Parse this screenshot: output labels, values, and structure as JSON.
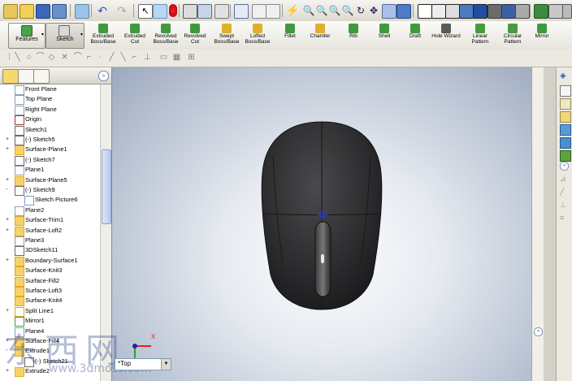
{
  "command_manager": {
    "features_tab": "Features",
    "sketch_tab": "Sketch",
    "commands": [
      {
        "label": "Extruded Boss/Base",
        "line1": "Extruded",
        "line2": "Boss/Base",
        "icon": "extrude-boss-icon"
      },
      {
        "label": "Extruded Cut",
        "line1": "Extruded",
        "line2": "Cut",
        "icon": "extrude-cut-icon"
      },
      {
        "label": "Revolved Boss/Base",
        "line1": "Revolved",
        "line2": "Boss/Base",
        "icon": "revolve-boss-icon"
      },
      {
        "label": "Revolved Cut",
        "line1": "Revolved",
        "line2": "Cut",
        "icon": "revolve-cut-icon"
      },
      {
        "label": "Swept Boss/Base",
        "line1": "Swept",
        "line2": "Boss/Base",
        "icon": "sweep-icon"
      },
      {
        "label": "Lofted Boss/Base",
        "line1": "Lofted",
        "line2": "Boss/Base",
        "icon": "loft-icon"
      },
      {
        "label": "Fillet",
        "line1": "Fillet",
        "line2": "",
        "icon": "fillet-icon"
      },
      {
        "label": "Chamfer",
        "line1": "Chamfer",
        "line2": "",
        "icon": "chamfer-icon"
      },
      {
        "label": "Rib",
        "line1": "Rib",
        "line2": "",
        "icon": "rib-icon"
      },
      {
        "label": "Shell",
        "line1": "Shell",
        "line2": "",
        "icon": "shell-icon"
      },
      {
        "label": "Draft",
        "line1": "Draft",
        "line2": "",
        "icon": "draft-icon"
      },
      {
        "label": "Hole Wizard",
        "line1": "Hole Wizard",
        "line2": "",
        "icon": "hole-wizard-icon"
      },
      {
        "label": "Linear Pattern",
        "line1": "Linear",
        "line2": "Pattern",
        "icon": "linear-pattern-icon"
      },
      {
        "label": "Circular Pattern",
        "line1": "Circular",
        "line2": "Pattern",
        "icon": "circular-pattern-icon"
      },
      {
        "label": "Mirror",
        "line1": "Mirror",
        "line2": "",
        "icon": "mirror-icon"
      }
    ]
  },
  "feature_tree": [
    {
      "label": "Front Plane",
      "icon": "plane-icon",
      "expand": ""
    },
    {
      "label": "Top Plane",
      "icon": "plane-icon",
      "expand": ""
    },
    {
      "label": "Right Plane",
      "icon": "plane-icon",
      "expand": ""
    },
    {
      "label": "Origin",
      "icon": "origin-icon",
      "expand": ""
    },
    {
      "label": "Sketch1",
      "icon": "sketch-icon",
      "expand": ""
    },
    {
      "label": "(-) Sketch5",
      "icon": "sketch-icon",
      "expand": "+"
    },
    {
      "label": "Surface-Plane1",
      "icon": "surface-plane-icon",
      "expand": "+"
    },
    {
      "label": "(-) Sketch7",
      "icon": "sketch-icon",
      "expand": ""
    },
    {
      "label": "Plane1",
      "icon": "plane-icon",
      "expand": ""
    },
    {
      "label": "Surface-Plane5",
      "icon": "surface-plane-icon",
      "expand": "+"
    },
    {
      "label": "(-) Sketch9",
      "icon": "sketch-icon",
      "expand": "-"
    },
    {
      "label": "Sketch Picture6",
      "icon": "sketch-picture-icon",
      "expand": "",
      "indent": 1
    },
    {
      "label": "Plane2",
      "icon": "plane-icon",
      "expand": ""
    },
    {
      "label": "Surface-Trim1",
      "icon": "surface-trim-icon",
      "expand": "+"
    },
    {
      "label": "Surface-Loft2",
      "icon": "surface-loft-icon",
      "expand": "+"
    },
    {
      "label": "Plane3",
      "icon": "plane-icon",
      "expand": ""
    },
    {
      "label": "3DSketch11",
      "icon": "3d-sketch-icon",
      "expand": ""
    },
    {
      "label": "Boundary-Surface1",
      "icon": "boundary-surface-icon",
      "expand": "+"
    },
    {
      "label": "Surface-Knit3",
      "icon": "surface-knit-icon",
      "expand": ""
    },
    {
      "label": "Surface-Fill2",
      "icon": "surface-fill-icon",
      "expand": ""
    },
    {
      "label": "Surface-Loft3",
      "icon": "surface-loft-icon",
      "expand": ""
    },
    {
      "label": "Surface-Knit4",
      "icon": "surface-knit-icon",
      "expand": ""
    },
    {
      "label": "Split Line1",
      "icon": "split-line-icon",
      "expand": "+"
    },
    {
      "label": "Mirror1",
      "icon": "mirror-icon",
      "expand": ""
    },
    {
      "label": "Plane4",
      "icon": "plane-icon",
      "expand": ""
    },
    {
      "label": "Surface-Fill4",
      "icon": "surface-fill-icon",
      "expand": "+"
    },
    {
      "label": "Extrude1",
      "icon": "extrude-boss-icon",
      "expand": "-"
    },
    {
      "label": "(-) Sketch21",
      "icon": "sketch-icon",
      "expand": "",
      "indent": 1
    },
    {
      "label": "Extrude2",
      "icon": "extrude-boss-icon",
      "expand": "+"
    }
  ],
  "viewport": {
    "view_orientation": "*Top",
    "triad_x_label": "X"
  },
  "watermark": {
    "text": "东西网",
    "url": "www.3dmoss.com"
  },
  "colors": {
    "model_body": "#2e2e30",
    "tree_selection": "#316ac5",
    "viewport_center": "#fbfcfd",
    "viewport_edge": "#9ca8bd"
  }
}
